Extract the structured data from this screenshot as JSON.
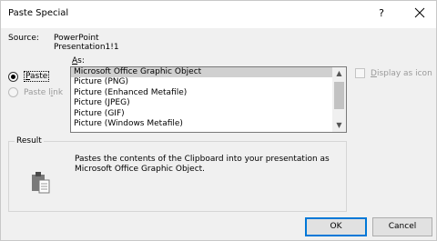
{
  "window": {
    "title": "Paste Special",
    "help_label": "?"
  },
  "source": {
    "label": "Source:",
    "line1": "PowerPoint",
    "line2": "Presentation1!1"
  },
  "as": {
    "label_mnemonic": "A",
    "label_rest": "s:"
  },
  "paste_options": {
    "paste": {
      "mnemonic": "P",
      "rest": "aste",
      "checked": true
    },
    "paste_link": {
      "prefix": "Paste l",
      "mnemonic": "i",
      "rest": "nk",
      "enabled": false
    }
  },
  "format_list": {
    "items": [
      "Microsoft Office Graphic Object",
      "Picture (PNG)",
      "Picture (Enhanced Metafile)",
      "Picture (JPEG)",
      "Picture (GIF)",
      "Picture (Windows Metafile)"
    ],
    "selected_index": 0
  },
  "display_as_icon": {
    "mnemonic": "D",
    "rest": "isplay as icon",
    "checked": false,
    "enabled": false
  },
  "result": {
    "legend": "Result",
    "text": "Pastes the contents of the Clipboard into your presentation as Microsoft Office Graphic Object.",
    "icon": "clipboard-icon"
  },
  "buttons": {
    "ok": "OK",
    "cancel": "Cancel"
  },
  "colors": {
    "accent": "#0078d7",
    "selection": "#d0d0d0",
    "disabled_text": "#9a9a9a"
  }
}
